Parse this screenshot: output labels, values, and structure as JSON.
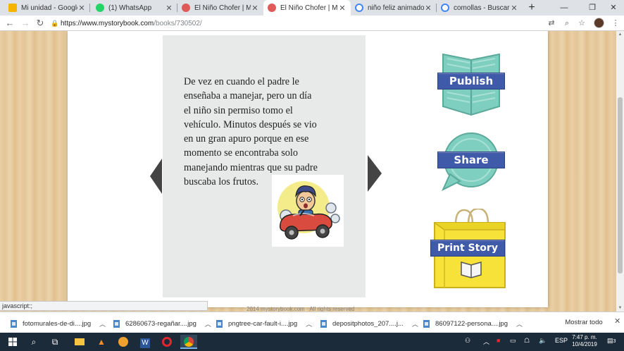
{
  "browser": {
    "tabs": [
      {
        "label": "Mi unidad - Google Dr",
        "favicon_color": "#f4b400",
        "active": false
      },
      {
        "label": "(1) WhatsApp",
        "favicon_color": "#25d366",
        "active": false
      },
      {
        "label": "El Niño Chofer | My Sto",
        "favicon_color": "#e05a5a",
        "active": false
      },
      {
        "label": "El Niño Chofer | My Sto",
        "favicon_color": "#e05a5a",
        "active": true
      },
      {
        "label": "niño feliz animado - Bu",
        "favicon_color": "#4285f4",
        "active": false
      },
      {
        "label": "comollas - Buscar con G",
        "favicon_color": "#4285f4",
        "active": false
      }
    ],
    "new_tab_glyph": "+",
    "url_host": "https://www.mystorybook.com",
    "url_path": "/books/730502/"
  },
  "story": {
    "lines": [
      "De vez en cuando el padre le",
      "enseñaba a manejar, pero un día",
      "el niño sin permiso tomo el",
      "vehículo. Minutos después  se vio",
      "en un gran apuro porque en ese",
      "momento se encontraba solo",
      "manejando mientras que su padre",
      "buscaba los frutos."
    ]
  },
  "actions": {
    "publish": "Publish",
    "share": "Share",
    "print": "Print Story"
  },
  "footer_text": "2014 mystorybook.com · All rights reserved",
  "status_text": "javascript:;",
  "downloads": {
    "items": [
      {
        "name": "fotomurales-de-di....jpg"
      },
      {
        "name": "62860673-regañar....jpg"
      },
      {
        "name": "pngtree-car-fault-i....jpg"
      },
      {
        "name": "depositphotos_207....j..."
      },
      {
        "name": "86097122-persona....jpg"
      }
    ],
    "show_all": "Mostrar todo"
  },
  "taskbar": {
    "lang": "ESP",
    "time": "7:47 p. m.",
    "date": "10/4/2019",
    "notification_count": "3"
  }
}
